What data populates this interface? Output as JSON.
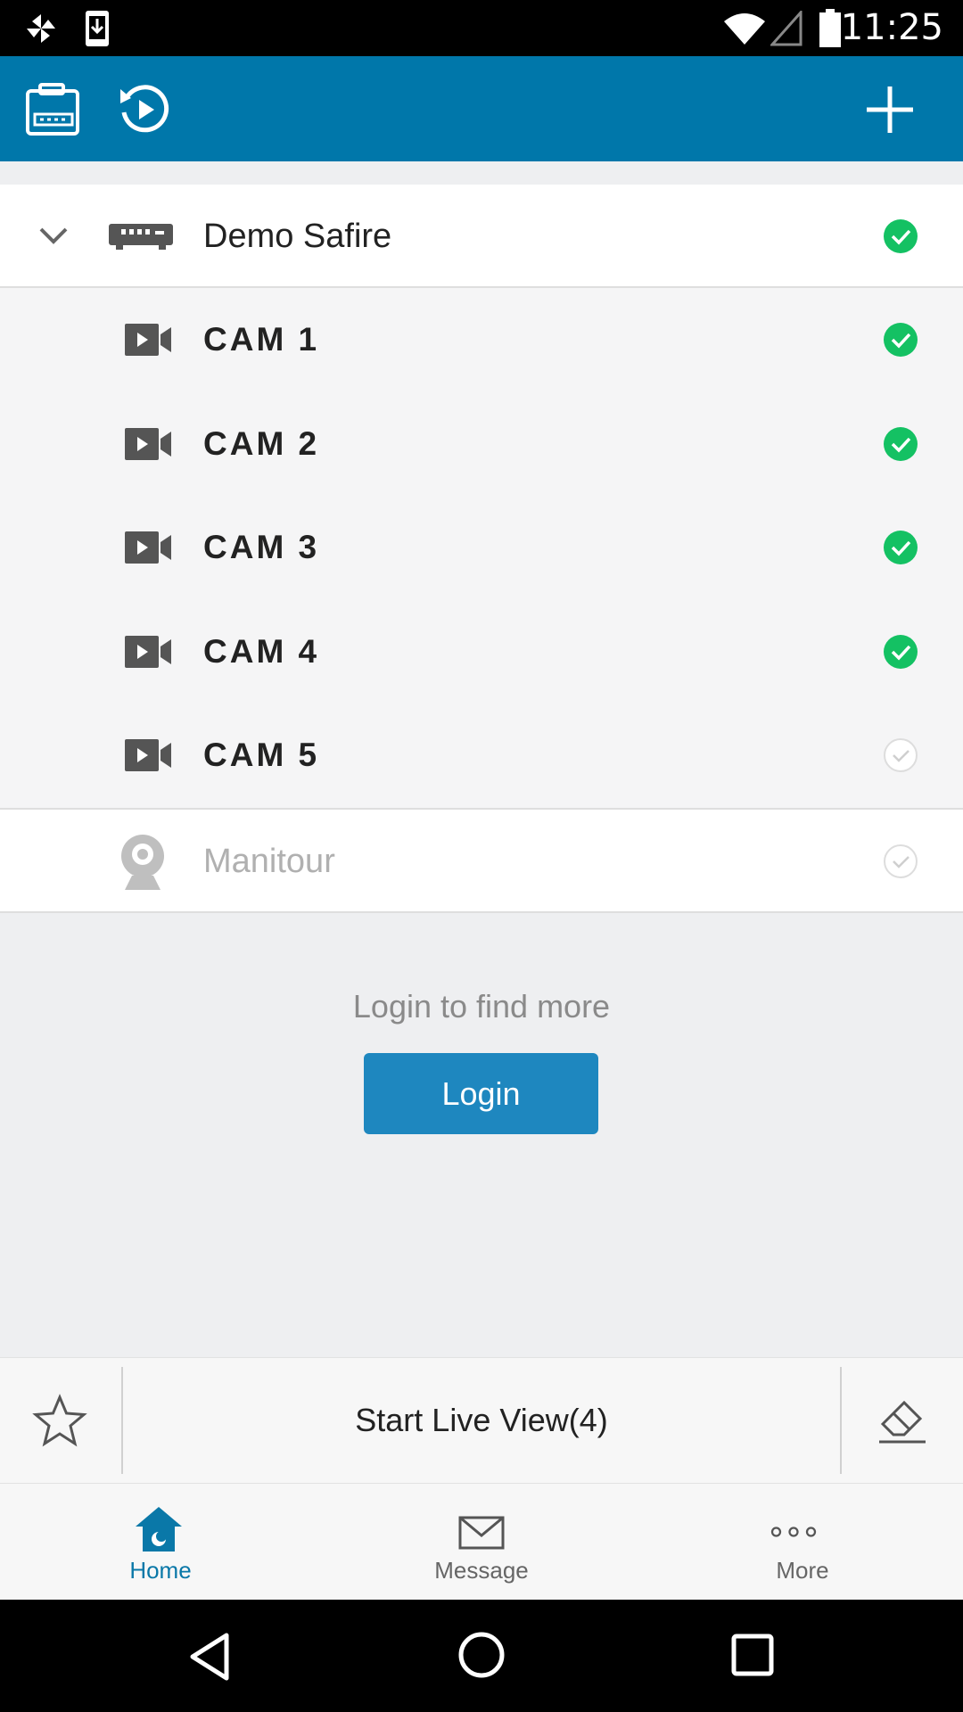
{
  "status_bar": {
    "time": "11:25"
  },
  "device": {
    "name": "Demo Safire",
    "online": true
  },
  "cameras": [
    {
      "label": "CAM 1",
      "online": true
    },
    {
      "label": "CAM 2",
      "online": true
    },
    {
      "label": "CAM 3",
      "online": true
    },
    {
      "label": "CAM 4",
      "online": true
    },
    {
      "label": "CAM 5",
      "online": false
    }
  ],
  "other_device": {
    "name": "Manitour",
    "online": false
  },
  "login": {
    "hint": "Login to find more",
    "button_label": "Login"
  },
  "action_bar": {
    "start_live_label": "Start Live View(4)"
  },
  "bottom_nav": {
    "items": [
      {
        "label": "Home",
        "active": true
      },
      {
        "label": "Message",
        "active": false
      },
      {
        "label": "More",
        "active": false
      }
    ]
  },
  "colors": {
    "appbar": "#0077aa",
    "accent": "#1e87bf",
    "online_green": "#14c163",
    "nav_active": "#0a78a8"
  },
  "icons": [
    "pinwheel-icon",
    "download-icon",
    "wifi-icon",
    "signal-icon",
    "battery-icon",
    "device-list-icon",
    "playback-icon",
    "add-icon",
    "chevron-down-icon",
    "dvr-icon",
    "camera-icon",
    "webcam-icon",
    "check-circle-icon",
    "star-icon",
    "eraser-icon",
    "home-icon",
    "message-icon",
    "more-icon",
    "back-icon",
    "home-circle-icon",
    "recents-icon"
  ]
}
